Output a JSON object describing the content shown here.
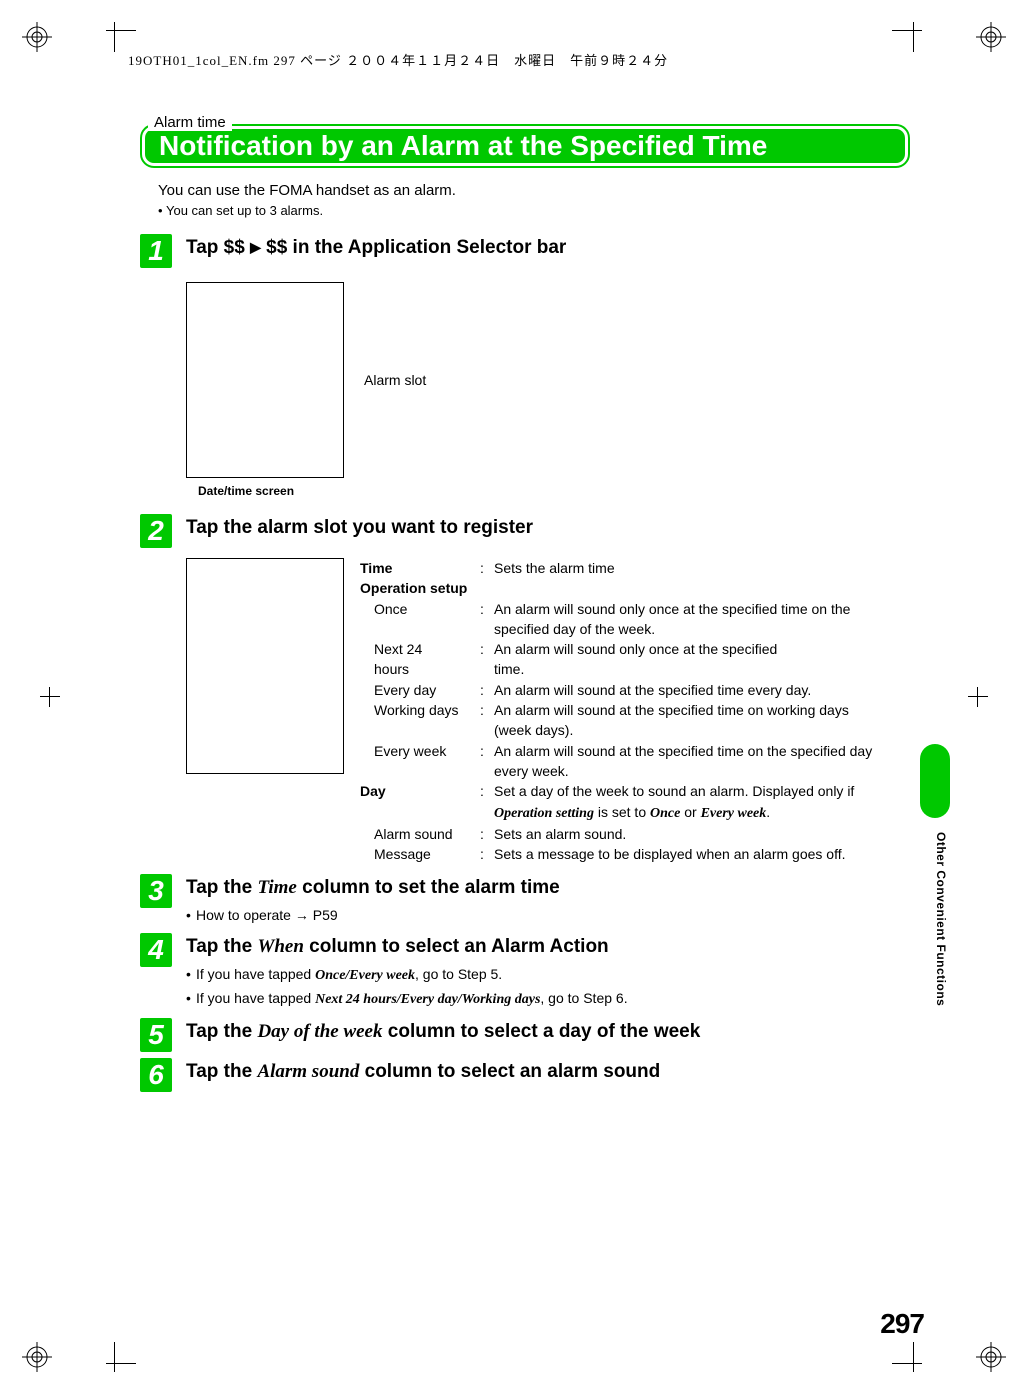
{
  "header_line": "19OTH01_1col_EN.fm  297 ページ  ２００４年１１月２４日　水曜日　午前９時２４分",
  "eyebrow": "Alarm time",
  "title": "Notification by an Alarm at the Specified Time",
  "intro": "You can use the FOMA handset as an alarm.",
  "intro_bullet": "You can set up to 3 alarms.",
  "steps": {
    "s1": {
      "num": "1",
      "title_pre": "Tap $$ ",
      "title_tri": "▶",
      "title_post": " $$ in the Application Selector bar",
      "side_label": "Alarm slot",
      "caption": "Date/time screen"
    },
    "s2": {
      "num": "2",
      "title": "Tap the alarm slot you want to register",
      "defs": {
        "time_label": "Time",
        "time_desc": "Sets the alarm time",
        "op_label": "Operation setup",
        "once_label": "Once",
        "once_desc": "An alarm will sound only once at the specified time on the specified day of the week.",
        "next24_label1": "Next 24",
        "next24_label2": "hours",
        "next24_desc1": "An alarm will sound only once at the specified",
        "next24_desc2": "time.",
        "everyday_label": "Every day",
        "everyday_desc": "An alarm will sound at the specified time every day.",
        "working_label": "Working days",
        "working_desc": "An alarm will sound at the specified time on working days (week days).",
        "everyweek_label": "Every week",
        "everyweek_desc": "An alarm will sound at the specified time on the specified day every week.",
        "day_label": "Day",
        "day_desc_pre": "Set a day of the week to sound an alarm. Displayed only if ",
        "day_desc_ital1": "Operation setting",
        "day_desc_mid": " is set to ",
        "day_desc_ital2": "Once",
        "day_desc_or": " or ",
        "day_desc_ital3": "Every week",
        "day_desc_post": ".",
        "alarmsound_label": "Alarm sound",
        "alarmsound_desc": "Sets an alarm sound.",
        "message_label": "Message",
        "message_desc": "Sets a message to be displayed when an alarm goes off."
      }
    },
    "s3": {
      "num": "3",
      "title_pre": "Tap the ",
      "title_ital": "Time",
      "title_post": " column to set the alarm time",
      "note_pre": "How to operate ",
      "note_arrow": "→",
      "note_post": " P59"
    },
    "s4": {
      "num": "4",
      "title_pre": "Tap the ",
      "title_ital": "When",
      "title_post": " column to select an Alarm Action",
      "note1_pre": "If you have tapped ",
      "note1_ital": "Once/Every week",
      "note1_post": ", go to Step 5.",
      "note2_pre": "If you have tapped ",
      "note2_ital": "Next 24 hours/Every day/Working days",
      "note2_post": ", go to Step 6."
    },
    "s5": {
      "num": "5",
      "title_pre": "Tap the ",
      "title_ital": "Day of the week",
      "title_post": " column to select a day of the week"
    },
    "s6": {
      "num": "6",
      "title_pre": "Tap the ",
      "title_ital": "Alarm sound",
      "title_post": " column to select an alarm sound"
    }
  },
  "side_label": "Other Convenient Functions",
  "page_number": "297"
}
